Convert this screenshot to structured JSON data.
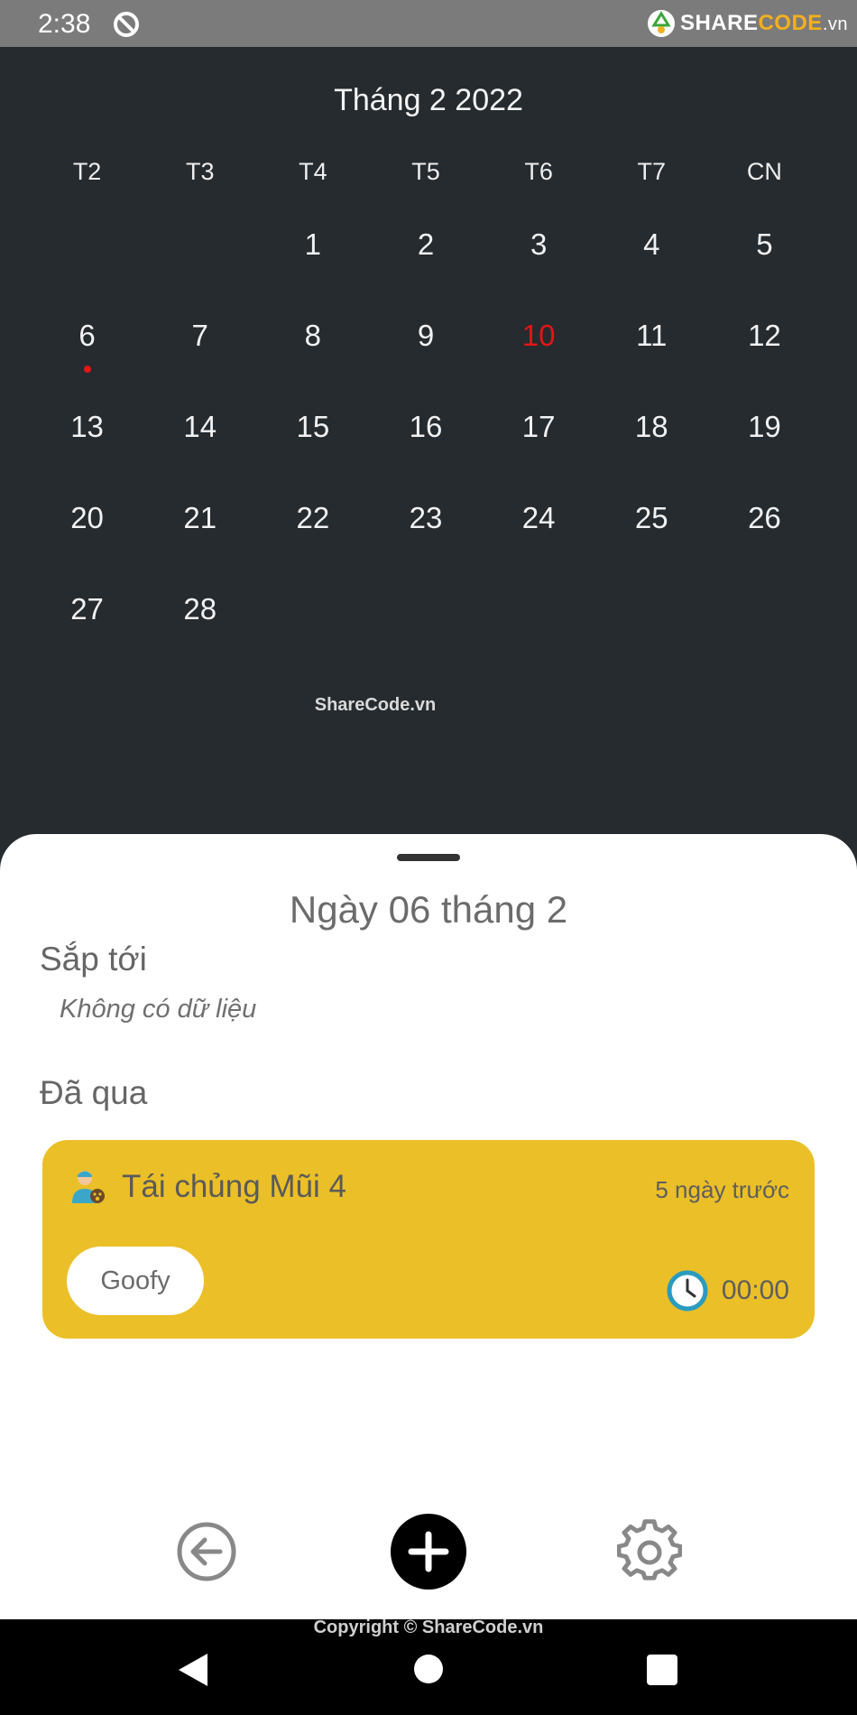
{
  "status_bar": {
    "time": "2:38",
    "logo": {
      "share": "SHARE",
      "code": "CODE",
      "vn": ".vn"
    }
  },
  "calendar": {
    "title": "Tháng 2 2022",
    "weekdays": [
      "T2",
      "T3",
      "T4",
      "T5",
      "T6",
      "T7",
      "CN"
    ],
    "leading_blanks": 2,
    "days": [
      "1",
      "2",
      "3",
      "4",
      "5",
      "6",
      "7",
      "8",
      "9",
      "10",
      "11",
      "12",
      "13",
      "14",
      "15",
      "16",
      "17",
      "18",
      "19",
      "20",
      "21",
      "22",
      "23",
      "24",
      "25",
      "26",
      "27",
      "28"
    ],
    "today": "10",
    "marked_days": [
      "6"
    ],
    "watermark": "ShareCode.vn"
  },
  "sheet": {
    "title": "Ngày 06 tháng 2",
    "upcoming_label": "Sắp tới",
    "empty_text": "Không có dữ liệu",
    "past_label": "Đã qua",
    "event": {
      "title": "Tái chủng Mũi 4",
      "ago": "5 ngày trước",
      "pet": "Goofy",
      "time": "00:00"
    },
    "card_color": "#ebbf27"
  },
  "bottom_nav": {
    "back_icon": "arrow-left-circle-icon",
    "add_icon": "plus-circle-icon",
    "settings_icon": "gear-icon"
  },
  "footer": {
    "copyright": "Copyright © ShareCode.vn"
  }
}
